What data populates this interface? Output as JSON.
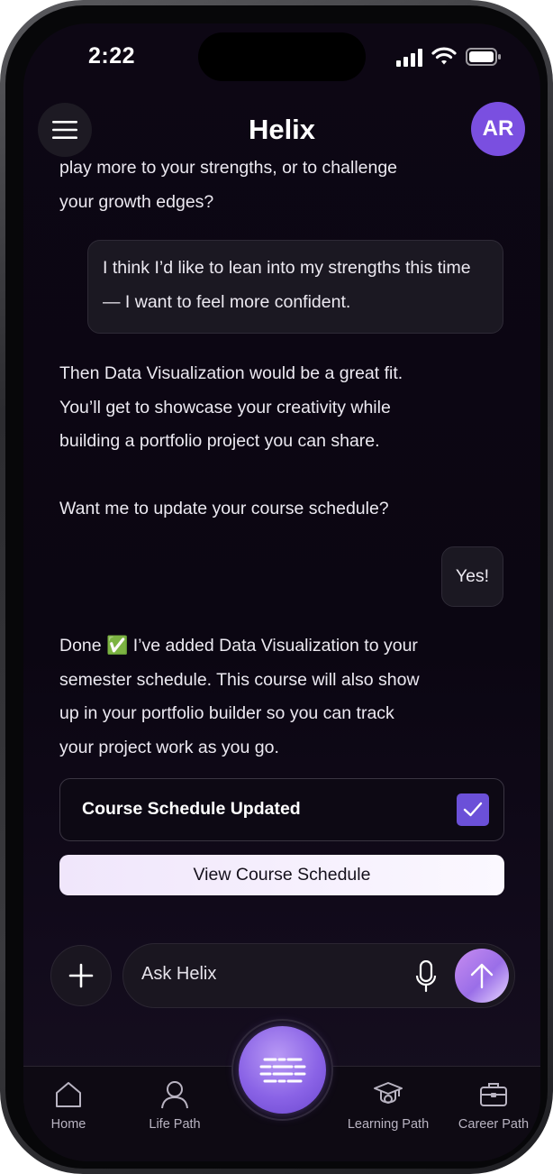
{
  "status_bar": {
    "time": "2:22"
  },
  "header": {
    "title": "Helix",
    "avatar_initials": "AR"
  },
  "conversation": {
    "ai_1": "play more to your strengths, or to challenge\nyour growth edges?",
    "user_1": "I think I’d like to lean into my strengths this time — I want to feel more confident.",
    "ai_2": "Then Data Visualization would be a great fit.\nYou’ll get to showcase your creativity while\nbuilding a portfolio project you can share.\n\nWant me to update your course schedule?",
    "user_2": "Yes!",
    "ai_3": "Done ✅ I’ve added Data Visualization to your\nsemester schedule. This course will also show\nup in your portfolio builder so you can track\nyour project work as you go."
  },
  "confirmation": {
    "label": "Course Schedule Updated",
    "checked": true
  },
  "actions": {
    "view_schedule": "View Course Schedule"
  },
  "composer": {
    "placeholder": "Ask Helix"
  },
  "tabs": [
    {
      "label": "Home",
      "icon": "home-icon"
    },
    {
      "label": "Life Path",
      "icon": "person-icon"
    },
    {
      "label": "Learning Path",
      "icon": "graduation-icon"
    },
    {
      "label": "Career Path",
      "icon": "briefcase-icon"
    }
  ],
  "colors": {
    "accent": "#7a4fe0",
    "checkbox": "#6b50d8",
    "background": "#0b0612"
  }
}
